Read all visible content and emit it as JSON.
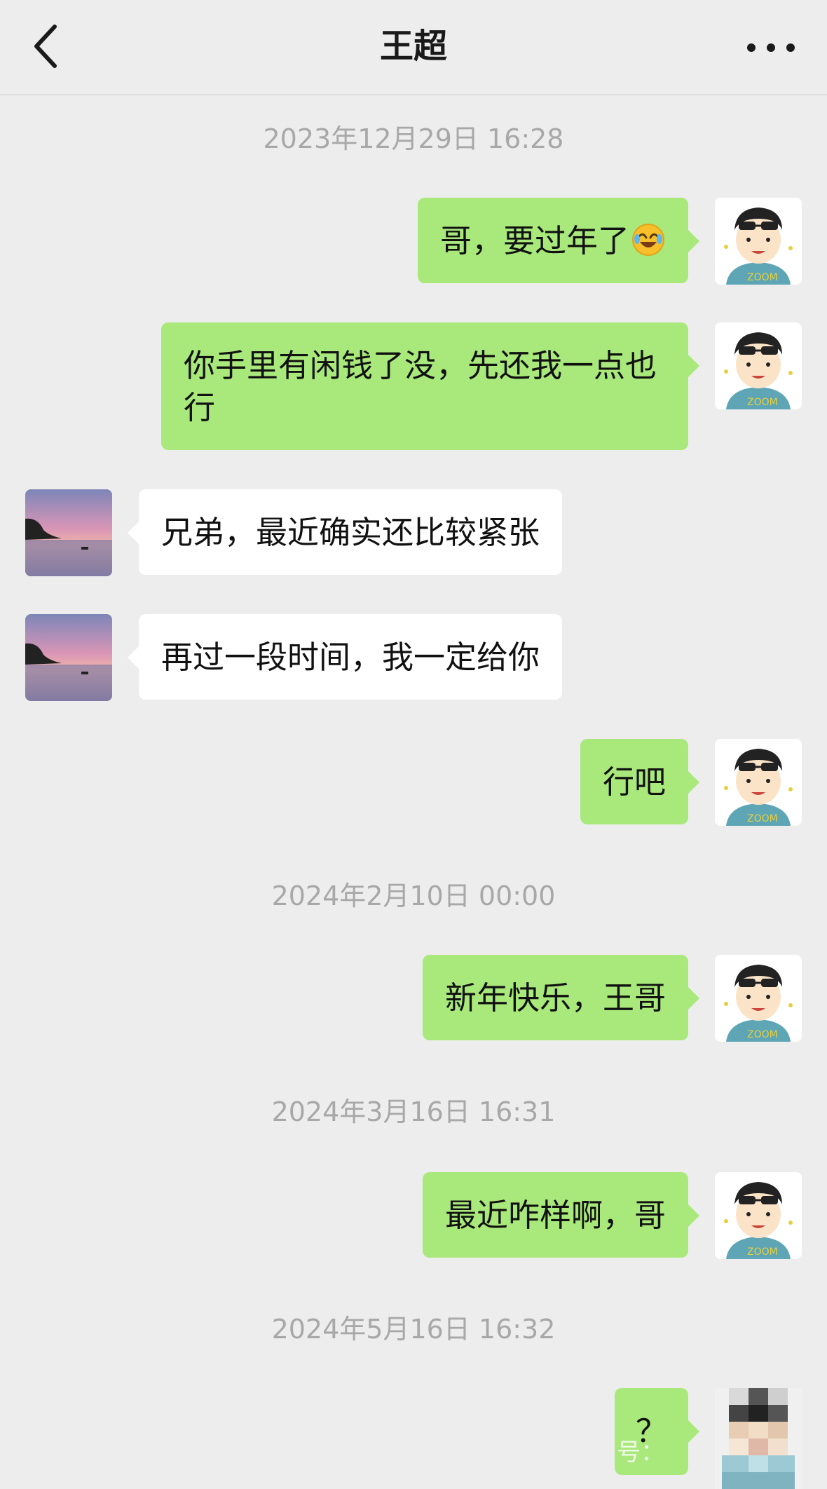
{
  "header": {
    "title": "王超"
  },
  "timestamps": [
    "2023年12月29日 16:28",
    "2024年2月10日 00:00",
    "2024年3月16日 16:31",
    "2024年5月16日 16:32"
  ],
  "messages": [
    {
      "sender": "me",
      "text": "哥，要过年了",
      "emoji": "laughing-crying-emoji"
    },
    {
      "sender": "me",
      "text": "你手里有闲钱了没，先还我一点也行"
    },
    {
      "sender": "friend",
      "text": "兄弟，最近确实还比较紧张"
    },
    {
      "sender": "friend",
      "text": "再过一段时间，我一定给你"
    },
    {
      "sender": "me",
      "text": "行吧"
    },
    {
      "sender": "me",
      "text": "新年快乐，王哥"
    },
    {
      "sender": "me",
      "text": "最近咋样啊，哥"
    },
    {
      "sender": "me",
      "text": "？"
    }
  ],
  "watermark": "号：",
  "colors": {
    "background": "#ededed",
    "my_bubble": "#a9e97b",
    "friend_bubble": "#ffffff",
    "timestamp": "#a8a8a8"
  },
  "icons": {
    "back": "chevron-left-icon",
    "more": "more-dots-icon"
  }
}
